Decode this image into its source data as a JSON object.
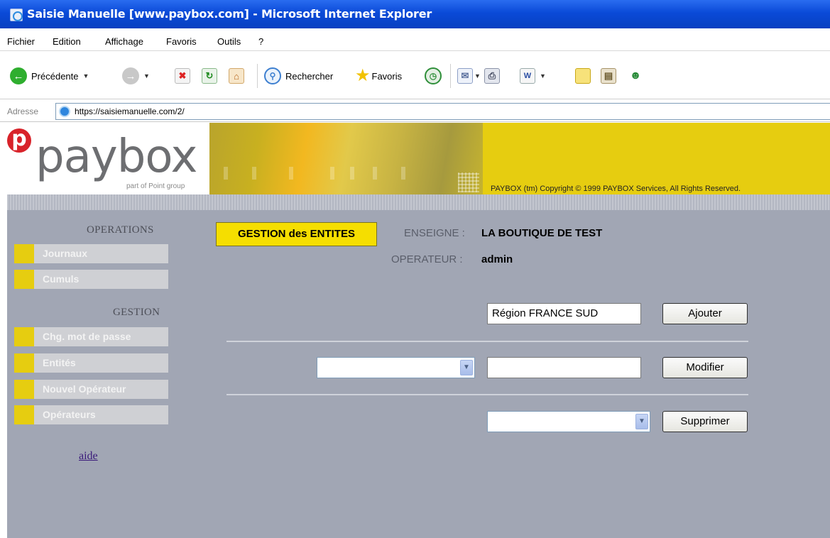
{
  "window": {
    "title": "Saisie Manuelle [www.paybox.com] - Microsoft Internet Explorer"
  },
  "menu": [
    "Fichier",
    "Edition",
    "Affichage",
    "Favoris",
    "Outils",
    "?"
  ],
  "toolbar": {
    "back_label": "Précédente",
    "search_label": "Rechercher",
    "favorites_label": "Favoris"
  },
  "address": {
    "label": "Adresse",
    "url": "https://saisiemanuelle.com/2/"
  },
  "banner": {
    "logo_text": "paybox",
    "logo_sub": "part of Point group",
    "copyright": "PAYBOX (tm) Copyright © 1999 PAYBOX Services, All Rights Reserved.",
    "brand_color": "#e6cd10"
  },
  "sidebar": {
    "operations_heading": "OPERATIONS",
    "operations_items": [
      "Journaux",
      "Cumuls"
    ],
    "gestion_heading": "GESTION",
    "gestion_items": [
      "Chg. mot de passe",
      "Entités",
      "Nouvel Opérateur",
      "Opérateurs"
    ],
    "help_link": "aide"
  },
  "main": {
    "section_tab": "GESTION des ENTITES",
    "enseigne_label": "ENSEIGNE :",
    "enseigne_value": "LA BOUTIQUE DE TEST",
    "operateur_label": "OPERATEUR :",
    "operateur_value": "admin",
    "add_input_value": "Région FRANCE SUD",
    "add_button": "Ajouter",
    "modify_select_value": "",
    "modify_input_value": "",
    "modify_button": "Modifier",
    "delete_select_value": "",
    "delete_button": "Supprimer"
  }
}
